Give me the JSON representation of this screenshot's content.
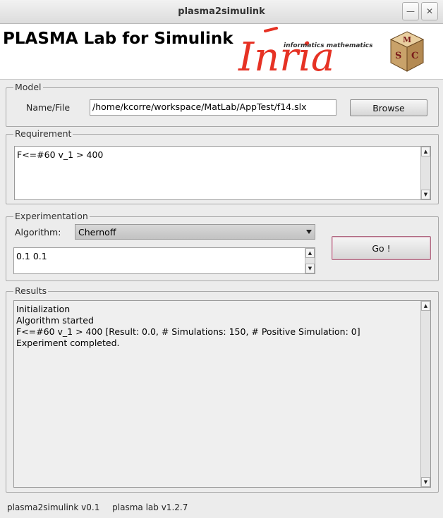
{
  "window": {
    "title": "plasma2simulink",
    "minimize_glyph": "—",
    "close_glyph": "✕"
  },
  "banner": {
    "app_title": "PLASMA Lab for Simulink",
    "inria_logo_word": "Inria",
    "inria_tagline": "informatics mathematics",
    "cube_letters": [
      "M",
      "C",
      "S"
    ]
  },
  "model": {
    "legend": "Model",
    "name_file_label": "Name/File",
    "file_path": "/home/kcorre/workspace/MatLab/AppTest/f14.slx",
    "browse_label": "Browse"
  },
  "requirement": {
    "legend": "Requirement",
    "text": "F<=#60 v_1 > 400"
  },
  "experimentation": {
    "legend": "Experimentation",
    "algorithm_label": "Algorithm:",
    "algorithm_selected": "Chernoff",
    "parameters": "0.1 0.1",
    "go_label": "Go !"
  },
  "results": {
    "legend": "Results",
    "lines": [
      "Initialization",
      "Algorithm started",
      "F<=#60 v_1 > 400 [Result: 0.0, # Simulations: 150, # Positive Simulation: 0]",
      "Experiment completed."
    ]
  },
  "status": {
    "plugin_version": "plasma2simulink v0.1",
    "lab_version": "plasma lab v1.2.7"
  },
  "icons": {
    "scroll_up": "arrow-up-icon",
    "scroll_down": "arrow-down-icon",
    "dropdown": "chevron-down-icon"
  },
  "colors": {
    "inria_red": "#e63224",
    "window_bg": "#ececec",
    "go_border": "#b06a82"
  }
}
